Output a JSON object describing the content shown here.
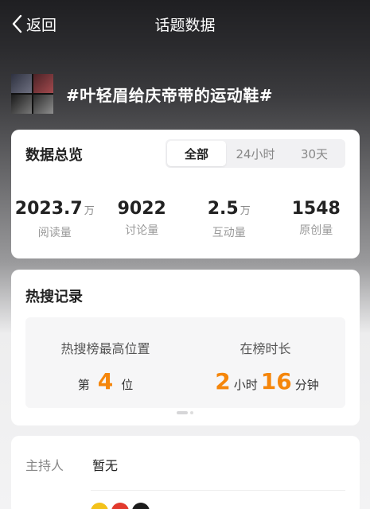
{
  "header": {
    "back_label": "返回",
    "title": "话题数据"
  },
  "topic": {
    "name": "#叶轻眉给庆帝带的运动鞋#"
  },
  "overview": {
    "title": "数据总览",
    "tabs": [
      "全部",
      "24小时",
      "30天"
    ],
    "active_tab": "全部",
    "stats": [
      {
        "value": "2023.7",
        "unit": "万",
        "label": "阅读量"
      },
      {
        "value": "9022",
        "unit": "",
        "label": "讨论量"
      },
      {
        "value": "2.5",
        "unit": "万",
        "label": "互动量"
      },
      {
        "value": "1548",
        "unit": "",
        "label": "原创量"
      }
    ]
  },
  "hot_search": {
    "title": "热搜记录",
    "highest": {
      "label": "热搜榜最高位置",
      "prefix": "第",
      "value": "4",
      "suffix": "位"
    },
    "duration": {
      "label": "在榜时长",
      "hours": "2",
      "hours_unit": "小时",
      "minutes": "16",
      "minutes_unit": "分钟"
    }
  },
  "host": {
    "label": "主持人",
    "value": "暂无"
  },
  "colors": {
    "accent": "#f5860b"
  }
}
